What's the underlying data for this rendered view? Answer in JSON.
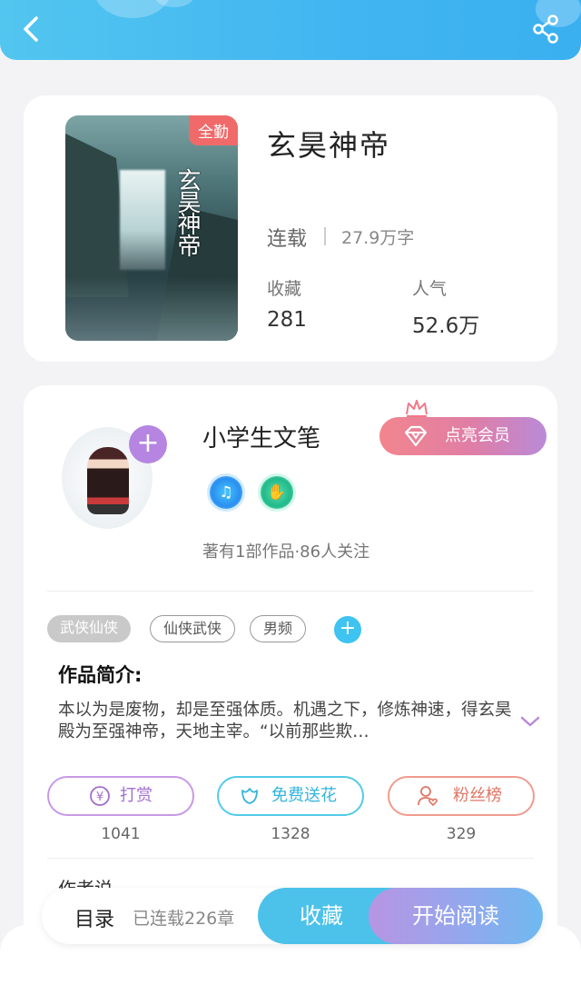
{
  "header": {
    "back_icon": "chevron-left-icon",
    "share_icon": "share-icon",
    "accent": "#41b5f1"
  },
  "book": {
    "cover_badge": "全勤",
    "cover_title_art": "玄昊神帝",
    "title": "玄昊神帝",
    "status": "连载",
    "word_count": "27.9万字",
    "stats": [
      {
        "label": "收藏",
        "value": "281"
      },
      {
        "label": "人气",
        "value": "52.6万"
      }
    ]
  },
  "author": {
    "name": "小学生文笔",
    "add_icon": "+",
    "vip_button": "点亮会员",
    "medals": [
      "music-medal-icon",
      "handshake-medal-icon"
    ],
    "meta": "著有1部作品·86人关注"
  },
  "tags": [
    "武侠仙侠",
    "仙侠武侠",
    "男频"
  ],
  "tag_add": "+",
  "intro": {
    "title": "作品简介:",
    "text": "本以为是废物，却是至强体质。机遇之下，修炼神速，得玄昊殿为至强神帝，天地主宰。“以前那些欺…"
  },
  "actions": [
    {
      "label": "打赏",
      "count": "1041",
      "icon": "yen-icon"
    },
    {
      "label": "免费送花",
      "count": "1328",
      "icon": "flower-icon"
    },
    {
      "label": "粉丝榜",
      "count": "329",
      "icon": "fans-icon"
    }
  ],
  "peek_text": "作者说",
  "bottom_bar": {
    "toc": "目录",
    "chapters": "已连载226章",
    "collect": "收藏",
    "read": "开始阅读"
  }
}
